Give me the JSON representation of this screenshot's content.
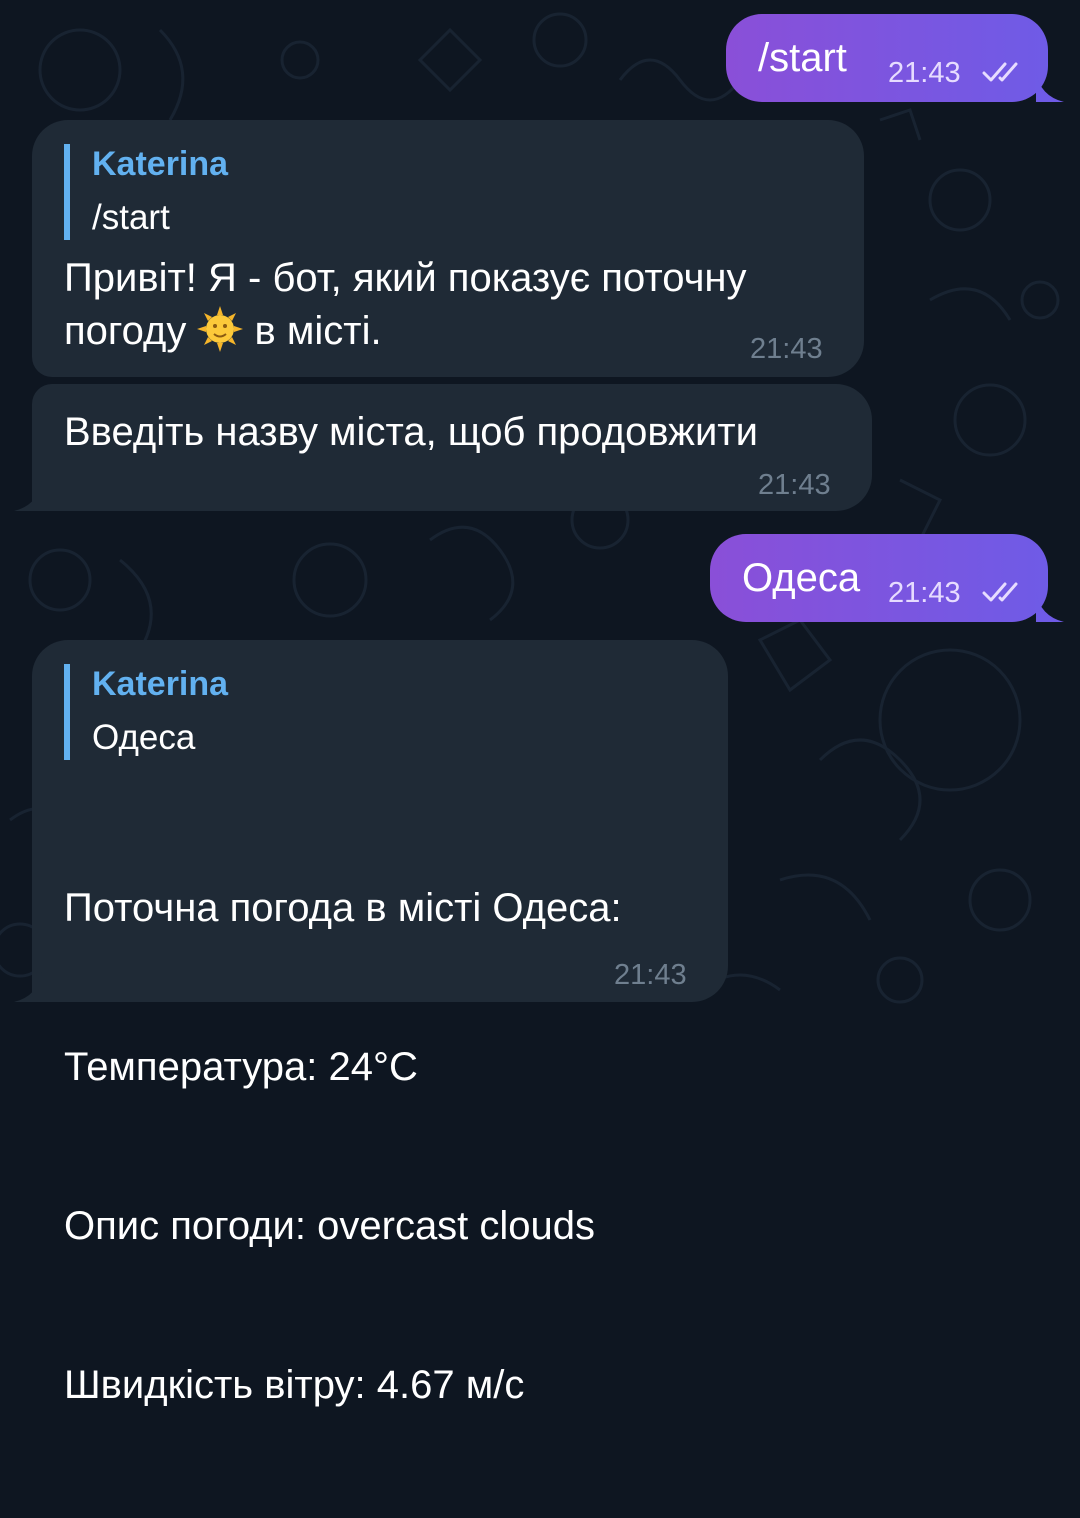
{
  "messages": {
    "m1": {
      "text": "/start",
      "time": "21:43",
      "status": "read"
    },
    "m2": {
      "reply_name": "Katerina",
      "reply_text": "/start",
      "text_before": "Привіт! Я - бот, який показує поточну\nпогоду ",
      "emoji": "sun-with-face-icon",
      "text_after": " в місті.",
      "time": "21:43"
    },
    "m3": {
      "text": "Введіть назву міста, щоб продовжити",
      "time": "21:43"
    },
    "m4": {
      "text": "Одеса",
      "time": "21:43",
      "status": "read"
    },
    "m5": {
      "reply_name": "Katerina",
      "reply_text": "Одеса",
      "line1": "Поточна погода в місті Одеса:",
      "line2": "Температура: 24°C",
      "line3": "Опис погоди: overcast clouds",
      "line4": "Швидкість вітру: 4.67 м/с",
      "time": "21:43"
    }
  },
  "colors": {
    "background": "#0e1621",
    "incoming": "#1f2a36",
    "outgoing_start": "#8a4fd8",
    "outgoing_end": "#6f5be6",
    "reply_accent": "#62b1f0"
  }
}
